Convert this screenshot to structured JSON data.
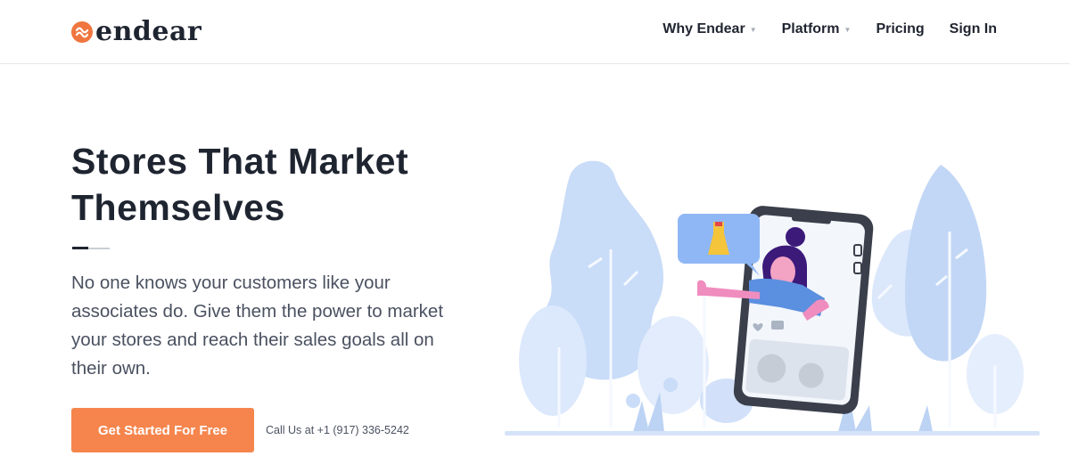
{
  "brand": {
    "name": "endear",
    "accent": "#f0763f"
  },
  "nav": {
    "items": [
      {
        "label": "Why Endear",
        "has_dropdown": true
      },
      {
        "label": "Platform",
        "has_dropdown": true
      },
      {
        "label": "Pricing",
        "has_dropdown": false
      },
      {
        "label": "Sign In",
        "has_dropdown": false
      }
    ]
  },
  "hero": {
    "title_line1": "Stores That Market",
    "title_line2": "Themselves",
    "description": "No one knows your customers like your associates do. Give them the power to market your stores and reach their sales goals all on their own.",
    "cta_label": "Get Started For Free",
    "call_text": "Call Us at +1 (917) 336-5242"
  },
  "colors": {
    "cta": "#f5854d",
    "text": "#1f2530",
    "muted": "#4a5160",
    "illustration_blue": "#cfe0f9"
  }
}
